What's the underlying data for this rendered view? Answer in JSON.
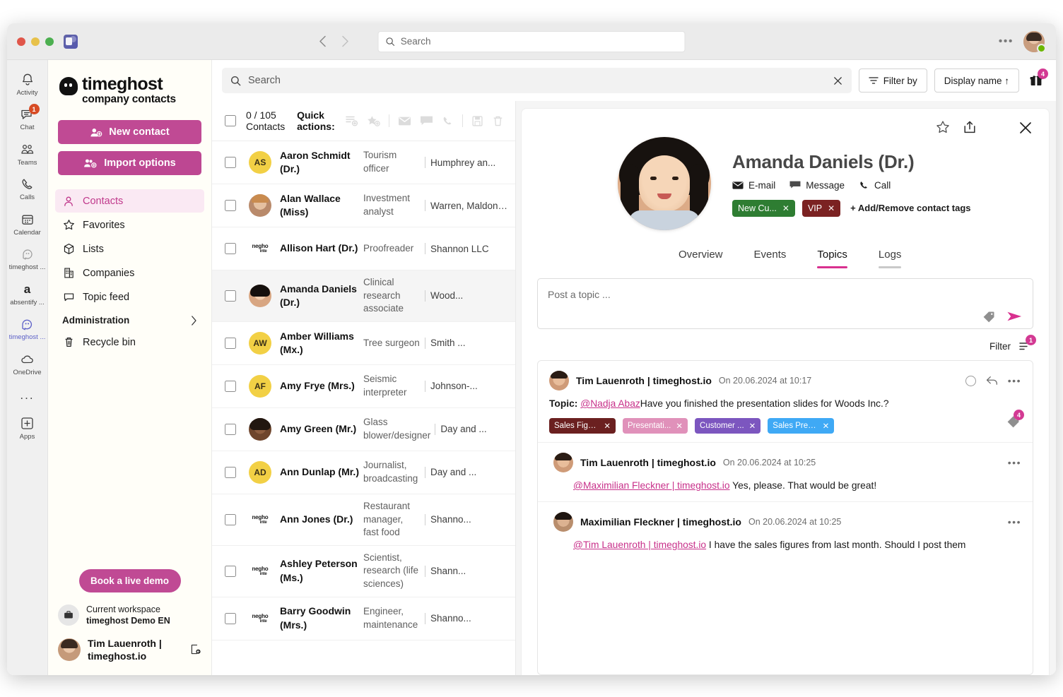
{
  "window": {
    "titlebar": {
      "search_placeholder": "Search",
      "search_value": "",
      "back_icon": "chevron-left-icon",
      "forward_icon": "chevron-right-icon",
      "more_icon": "ellipsis-icon",
      "app_icon": "teams-icon"
    }
  },
  "rail": {
    "items": [
      {
        "label": "Activity",
        "icon": "bell-icon",
        "badge": "",
        "active": false
      },
      {
        "label": "Chat",
        "icon": "chat-icon",
        "badge": "1",
        "active": false
      },
      {
        "label": "Teams",
        "icon": "teams-people-icon",
        "badge": "",
        "active": false
      },
      {
        "label": "Calls",
        "icon": "phone-icon",
        "badge": "",
        "active": false
      },
      {
        "label": "Calendar",
        "icon": "calendar-icon",
        "badge": "",
        "active": false
      },
      {
        "label": "timeghost ...",
        "icon": "timeghost-icon",
        "badge": "",
        "active": false
      },
      {
        "label": "absentify ...",
        "icon": "absentify-icon",
        "badge": "",
        "active": false
      },
      {
        "label": "timeghost ...",
        "icon": "timeghost-contacts-icon",
        "badge": "",
        "active": true
      },
      {
        "label": "OneDrive",
        "icon": "cloud-icon",
        "badge": "",
        "active": false
      }
    ],
    "more_label": "...",
    "apps_label": "Apps",
    "apps_icon": "plus-box-icon"
  },
  "sidebar": {
    "brand_line1": "timeghost",
    "brand_line2": "company contacts",
    "new_contact_label": "New contact",
    "import_options_label": "Import options",
    "nav": [
      {
        "label": "Contacts",
        "icon": "person-icon",
        "selected": true
      },
      {
        "label": "Favorites",
        "icon": "star-icon",
        "selected": false
      },
      {
        "label": "Lists",
        "icon": "box-icon",
        "selected": false
      },
      {
        "label": "Companies",
        "icon": "building-icon",
        "selected": false
      },
      {
        "label": "Topic feed",
        "icon": "comment-icon",
        "selected": false
      }
    ],
    "administration_label": "Administration",
    "administration_chevron": "chevron-right-icon",
    "recycle_bin_label": "Recycle bin",
    "recycle_bin_icon": "trash-icon",
    "demo_button_label": "Book a live demo",
    "workspace_label": "Current workspace",
    "workspace_name": "timeghost Demo EN",
    "workspace_icon": "briefcase-icon",
    "user_name": "Tim Lauenroth |",
    "user_domain": "timeghost.io",
    "switch_icon": "switch-account-icon"
  },
  "list": {
    "search_placeholder": "Search",
    "search_value": "",
    "clear_icon": "close-icon",
    "filter_label": "Filter by",
    "filter_icon": "filter-icon",
    "sort_label": "Display name ↑",
    "gift_icon": "gift-icon",
    "gift_badge": "4",
    "count_label": "0 / 105 Contacts",
    "quick_actions_label": "Quick actions:",
    "quick_action_icons": [
      "add-to-list-icon",
      "add-to-favorites-icon",
      "email-icon",
      "message-icon",
      "call-icon",
      "save-icon",
      "delete-icon"
    ],
    "contacts": [
      {
        "name": "Aaron Schmidt (Dr.)",
        "job": "Tourism officer",
        "company": "Humphrey an...",
        "avatar_type": "initials",
        "initials": "AS",
        "selected": false
      },
      {
        "name": "Alan Wallace (Miss)",
        "job": "Investment analyst",
        "company": "Warren, Maldonad...",
        "avatar_type": "photo1",
        "initials": "",
        "selected": false
      },
      {
        "name": "Allison Hart (Dr.)",
        "job": "Proofreader",
        "company": "Shannon LLC",
        "avatar_type": "logo",
        "initials": "",
        "selected": false
      },
      {
        "name": "Amanda Daniels (Dr.)",
        "job": "Clinical research associate",
        "company": "Wood...",
        "avatar_type": "photo2",
        "initials": "",
        "selected": true
      },
      {
        "name": "Amber Williams (Mx.)",
        "job": "Tree surgeon",
        "company": "Smith ...",
        "avatar_type": "initials",
        "initials": "AW",
        "selected": false
      },
      {
        "name": "Amy Frye (Mrs.)",
        "job": "Seismic interpreter",
        "company": "Johnson-...",
        "avatar_type": "initials",
        "initials": "AF",
        "selected": false
      },
      {
        "name": "Amy Green (Mr.)",
        "job": "Glass blower/designer",
        "company": "Day and ...",
        "avatar_type": "photo3",
        "initials": "",
        "selected": false
      },
      {
        "name": "Ann Dunlap (Mr.)",
        "job": "Journalist, broadcasting",
        "company": "Day and ...",
        "avatar_type": "initials",
        "initials": "AD",
        "selected": false
      },
      {
        "name": "Ann Jones (Dr.)",
        "job": "Restaurant manager, fast food",
        "company": "Shanno...",
        "avatar_type": "logo",
        "initials": "",
        "selected": false
      },
      {
        "name": "Ashley Peterson (Ms.)",
        "job": "Scientist, research (life sciences)",
        "company": "Shann...",
        "avatar_type": "logo",
        "initials": "",
        "selected": false
      },
      {
        "name": "Barry Goodwin (Mrs.)",
        "job": "Engineer, maintenance",
        "company": "Shanno...",
        "avatar_type": "logo",
        "initials": "",
        "selected": false
      }
    ],
    "company_logo_top": "negho",
    "company_logo_bottom": "inte"
  },
  "detail": {
    "favorite_icon": "star-outline-icon",
    "share_icon": "share-icon",
    "close_icon": "close-icon",
    "contact_name": "Amanda Daniels (Dr.)",
    "actions": [
      {
        "label": "E-mail",
        "icon": "email-icon"
      },
      {
        "label": "Message",
        "icon": "message-icon"
      },
      {
        "label": "Call",
        "icon": "call-icon"
      }
    ],
    "tags": [
      {
        "label": "New Cu...",
        "color": "#2E7D32"
      },
      {
        "label": "VIP",
        "color": "#7B2222"
      }
    ],
    "add_tags_label": "+ Add/Remove contact tags",
    "tabs": [
      {
        "label": "Overview",
        "active": false
      },
      {
        "label": "Events",
        "active": false
      },
      {
        "label": "Topics",
        "active": true
      },
      {
        "label": "Logs",
        "active": false
      }
    ],
    "composer_placeholder": "Post a topic ...",
    "composer_tag_icon": "tag-icon",
    "composer_send_icon": "send-icon",
    "filter_label": "Filter",
    "filter_icon": "filter-lines-icon",
    "filter_badge": "1",
    "posts": [
      {
        "author": "Tim Lauenroth | timeghost.io",
        "date": "On 20.06.2024 at 10:17",
        "topic_label": "Topic:",
        "mention": "@Nadja Abaz",
        "text": "Have you finished the presentation slides for Woods Inc.?",
        "is_reply": false,
        "has_circle": true,
        "has_reply_icon": true,
        "tags": [
          {
            "label": "Sales Figu...",
            "color": "#6B2020"
          },
          {
            "label": "Presentati...",
            "color": "#E091BA"
          },
          {
            "label": "Customer ...",
            "color": "#7C56BF"
          },
          {
            "label": "Sales Pres...",
            "color": "#3FA9F5"
          }
        ],
        "tag_badge": "4"
      },
      {
        "author": "Tim Lauenroth | timeghost.io",
        "date": "On 20.06.2024 at 10:25",
        "topic_label": "",
        "mention": "@Maximilian Fleckner | timeghost.io",
        "text": " Yes, please. That would be great!",
        "is_reply": true,
        "has_circle": false,
        "has_reply_icon": false,
        "tags": [],
        "tag_badge": ""
      },
      {
        "author": "Maximilian Fleckner | timeghost.io",
        "date": "On 20.06.2024 at 10:25",
        "topic_label": "",
        "mention": "@Tim Lauenroth | timeghost.io",
        "text": " I have the sales figures from last month. Should I post them",
        "is_reply": true,
        "has_circle": false,
        "has_reply_icon": false,
        "tags": [],
        "tag_badge": ""
      }
    ],
    "more_icon": "ellipsis-icon"
  },
  "colors": {
    "accent_pink": "#c04a94",
    "accent_magenta": "#d8308f",
    "avatar_yellow": "#f2d045",
    "sidebar_bg": "#fffef8"
  }
}
